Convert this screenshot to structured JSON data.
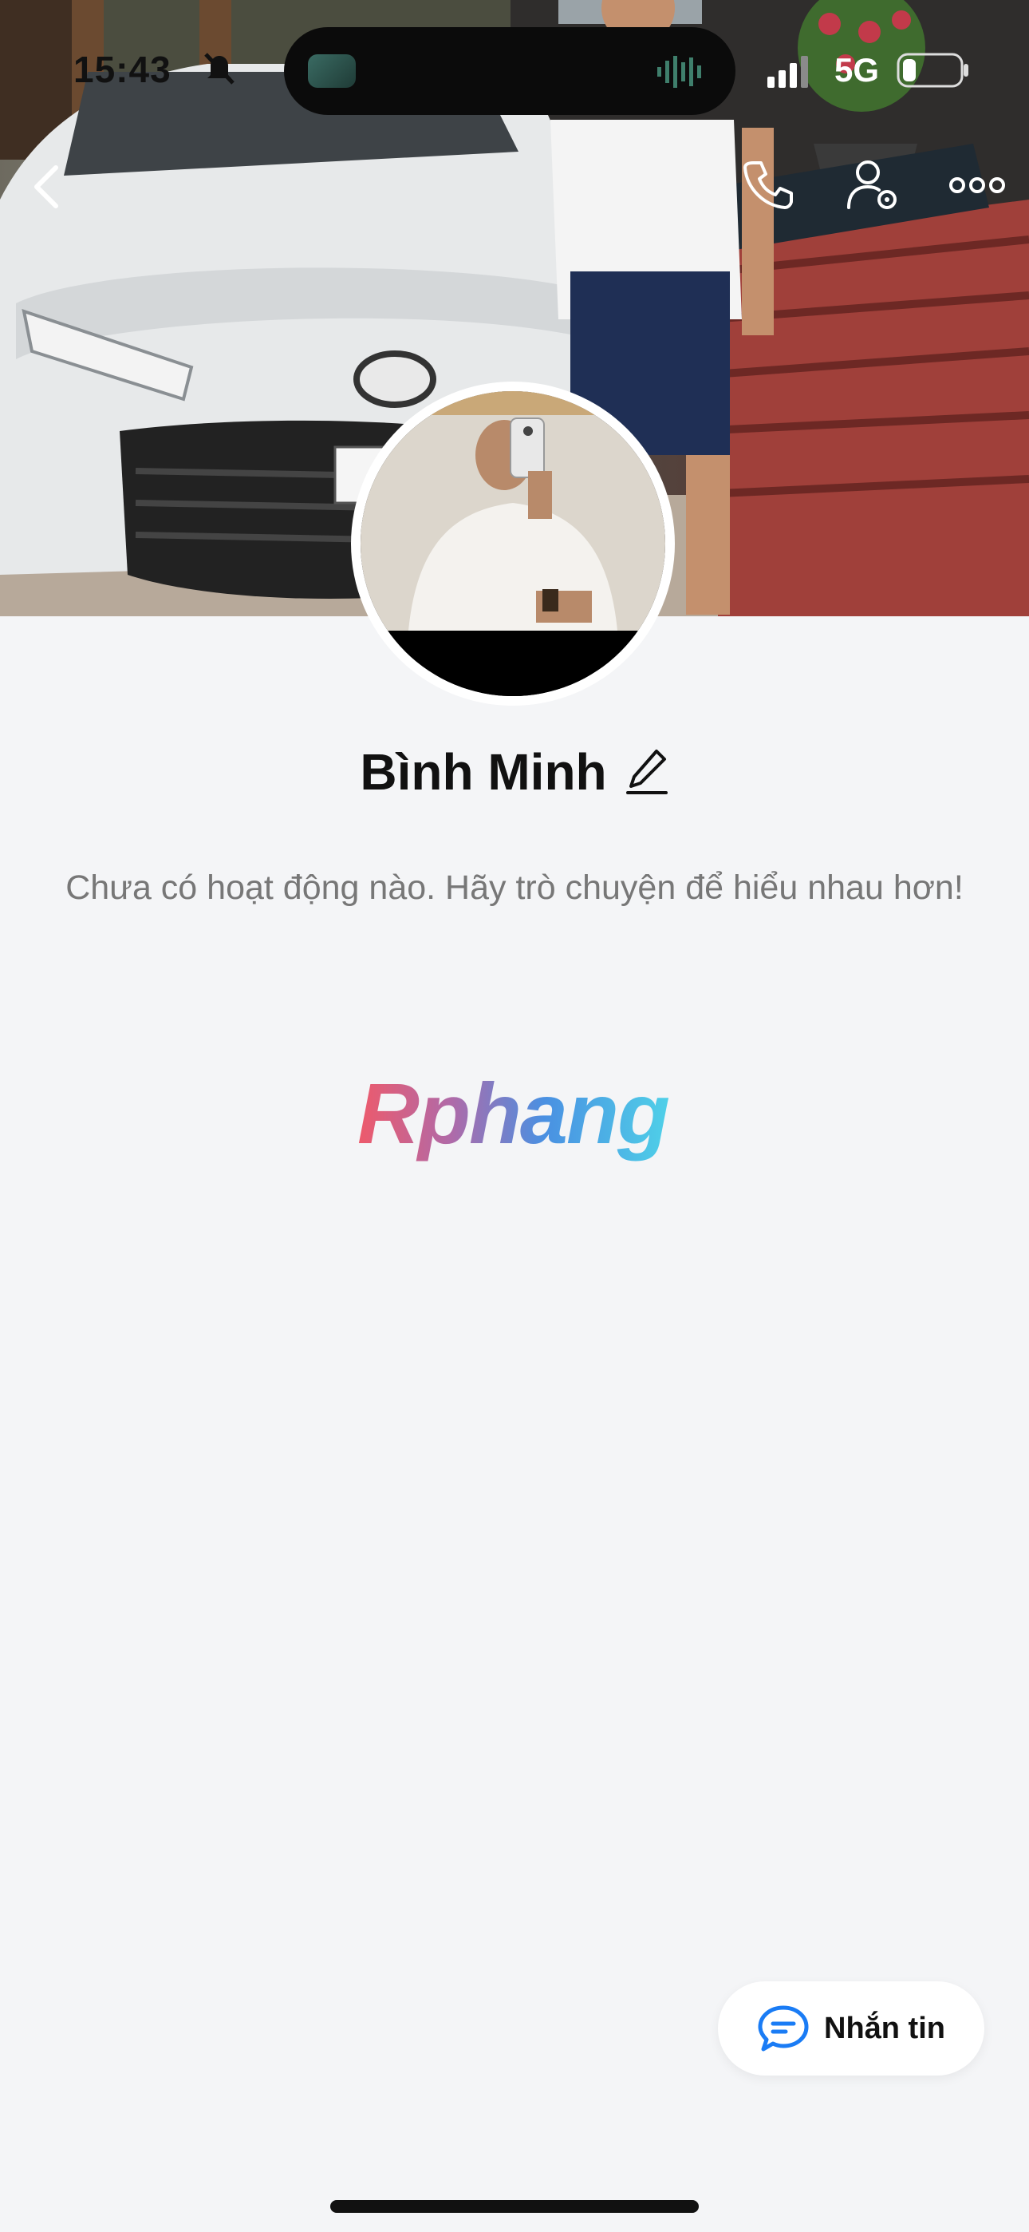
{
  "status_bar": {
    "time": "15:43",
    "network": "5G"
  },
  "profile": {
    "name": "Bình Minh",
    "empty_message": "Chưa có hoạt động nào. Hãy trò chuyện để hiểu nhau hơn!"
  },
  "watermark": {
    "text": "Rphang"
  },
  "actions": {
    "message_label": "Nhắn tin"
  },
  "icons": {
    "back": "chevron-left-icon",
    "call": "phone-icon",
    "settings": "user-settings-icon",
    "more": "more-icon",
    "edit": "pencil-icon",
    "message": "chat-bubble-icon"
  },
  "colors": {
    "accent": "#1a7cf5",
    "background": "#f4f5f7"
  }
}
